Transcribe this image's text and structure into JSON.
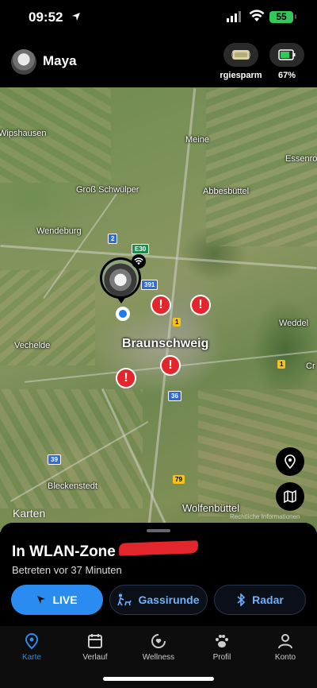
{
  "status": {
    "time": "09:52",
    "battery": "55"
  },
  "header": {
    "pet_name": "Maya",
    "devices": [
      {
        "label": "rgiesparm",
        "icon": "tracker-icon"
      },
      {
        "label": "67%",
        "icon": "battery-icon"
      }
    ]
  },
  "map": {
    "places": {
      "wipshausen": "Wipshausen",
      "meine": "Meine",
      "essenro": "Essenro",
      "gross_schwuelper": "Groß Schwülper",
      "abbesbuettel": "Abbesbüttel",
      "wendeburg": "Wendeburg",
      "vechelde": "Vechelde",
      "braunschweig": "Braunschweig",
      "weddel": "Weddel",
      "cr": "Cr",
      "bleckenstedt": "Bleckenstedt",
      "wolfenbuettel": "Wolfenbüttel"
    },
    "shields": {
      "s2": "2",
      "e30": "E30",
      "s391": "391",
      "s1": "1",
      "s1b": "1",
      "s36": "36",
      "s39": "39",
      "s79": "79"
    },
    "attribution": "Karten",
    "legal": "Rechtliche Informationen",
    "alert_glyph": "!"
  },
  "sheet": {
    "title": "In WLAN-Zone",
    "subtitle": "Betreten vor 37 Minuten",
    "buttons": {
      "live": "LIVE",
      "walk": "Gassirunde",
      "radar": "Radar"
    }
  },
  "tabs": [
    {
      "label": "Karte",
      "active": true
    },
    {
      "label": "Verlauf"
    },
    {
      "label": "Wellness"
    },
    {
      "label": "Profil"
    },
    {
      "label": "Konto"
    }
  ],
  "colors": {
    "accent": "#2a8cf0",
    "alert": "#e2262b",
    "battery": "#34c759"
  }
}
